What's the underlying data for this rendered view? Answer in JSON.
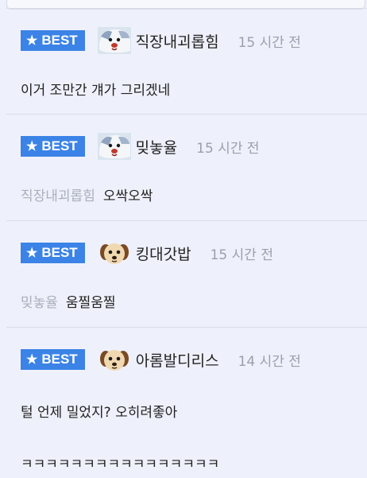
{
  "best_label": "BEST",
  "comments": [
    {
      "nickname": "직장내괴롭힘",
      "time": "15 시간 전",
      "avatar": "dog-fluffy-avatar",
      "reply_to": "",
      "lines": [
        "이거 조만간 걔가 그리겠네"
      ]
    },
    {
      "nickname": "밎놓율",
      "time": "15 시간 전",
      "avatar": "dog-fluffy-avatar",
      "reply_to": "직장내괴롭힘",
      "lines": [
        "오싹오싹"
      ]
    },
    {
      "nickname": "킹대갓밥",
      "time": "15 시간 전",
      "avatar": "puppy-face-avatar",
      "reply_to": "밎놓율",
      "lines": [
        "움찔움찔"
      ]
    },
    {
      "nickname": "아롬발디리스",
      "time": "14 시간 전",
      "avatar": "puppy-face-avatar",
      "reply_to": "",
      "lines": [
        "털 언제 밀었지? 오히려좋아",
        "ㅋㅋㅋㅋㅋㅋㅋㅋㅋㅋㅋㅋㅋㅋㅋㅋ"
      ]
    }
  ],
  "colors": {
    "background": "#eef1fb",
    "badge": "#3b83e6",
    "time_text": "#9aa0aa",
    "reply_to_text": "#aab0bb"
  }
}
